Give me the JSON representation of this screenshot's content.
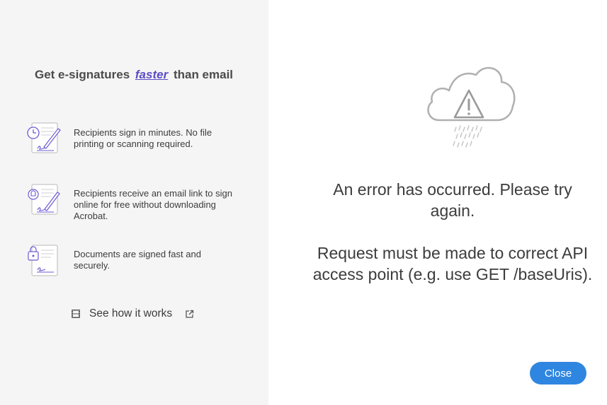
{
  "promo": {
    "headline_pre": "Get e-signatures",
    "headline_emphasis": "faster",
    "headline_post": "than email",
    "features": [
      {
        "icon": "signing-timer-icon",
        "text": "Recipients sign in minutes. No file printing or scanning required."
      },
      {
        "icon": "email-link-sign-icon",
        "text": "Recipients receive an email link to sign online for free without downloading Acrobat."
      },
      {
        "icon": "secure-document-icon",
        "text": "Documents are signed fast and securely."
      }
    ],
    "see_how_label": "See how it works",
    "see_how_icon": "film-icon",
    "external_icon": "external-link-icon"
  },
  "error": {
    "icon": "cloud-warning-icon",
    "message": "An error has occurred. Please try again.",
    "detail": "Request must be made to correct API access point (e.g. use GET /baseUris)."
  },
  "actions": {
    "close_label": "Close"
  },
  "colors": {
    "accent": "#2f86e0",
    "emphasis": "#5b4cc4",
    "left_panel_bg": "#f5f5f5",
    "text": "#3c3c3c"
  }
}
